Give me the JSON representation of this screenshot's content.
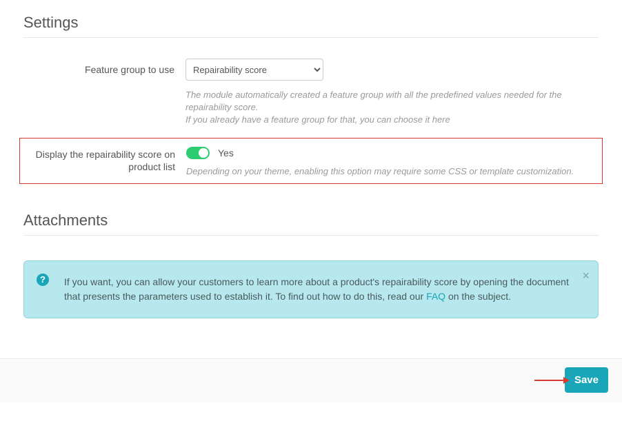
{
  "settings": {
    "title": "Settings",
    "feature_group": {
      "label": "Feature group to use",
      "selected": "Repairability score",
      "help_line1": "The module automatically created a feature group with all the predefined values needed for the repairability score.",
      "help_line2": "If you already have a feature group for that, you can choose it here"
    },
    "display_score": {
      "label": "Display the repairability score on product list",
      "value_label": "Yes",
      "on": true,
      "help": "Depending on your theme, enabling this option may require some CSS or template customization."
    }
  },
  "attachments": {
    "title": "Attachments",
    "alert_icon": "?",
    "alert_text_1": "If you want, you can allow your customers to learn more about a product's repairability score by opening the document that presents the parameters used to establish it. To find out how to do this, read our ",
    "alert_link": "FAQ",
    "alert_text_2": " on the subject.",
    "close": "×"
  },
  "footer": {
    "save": "Save"
  }
}
